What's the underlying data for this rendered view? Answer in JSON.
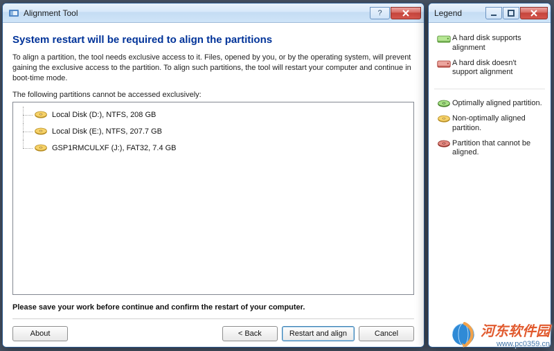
{
  "mainWindow": {
    "title": "Alignment Tool",
    "headline": "System restart will be required to align the partitions",
    "description": "To align a partition, the tool needs exclusive access to it. Files, opened by you, or by the operating system, will prevent gaining the exclusive access to the partition. To align such partitions, the tool will restart your computer and continue in boot-time mode.",
    "listLabel": "The following partitions cannot be accessed exclusively:",
    "partitions": [
      {
        "label": "Local Disk (D:), NTFS, 208 GB"
      },
      {
        "label": "Local Disk (E:), NTFS, 207.7 GB"
      },
      {
        "label": "GSP1RMCULXF (J:), FAT32, 7.4 GB"
      }
    ],
    "saveNote": "Please save your work before continue and confirm the restart of your computer.",
    "buttons": {
      "about": "About",
      "back": "< Back",
      "restart": "Restart and align",
      "cancel": "Cancel"
    }
  },
  "legendWindow": {
    "title": "Legend",
    "diskGroup": [
      {
        "color": "green",
        "text": "A hard disk supports alignment"
      },
      {
        "color": "red",
        "text": "A hard disk doesn't support alignment"
      }
    ],
    "partGroup": [
      {
        "color": "green",
        "text": "Optimally aligned partition."
      },
      {
        "color": "yellow",
        "text": "Non-optimally aligned partition."
      },
      {
        "color": "red",
        "text": "Partition that cannot be aligned."
      }
    ]
  },
  "helpGlyph": "?",
  "watermark": {
    "name": "河东软件园",
    "url": "www.pc0359.cn"
  }
}
